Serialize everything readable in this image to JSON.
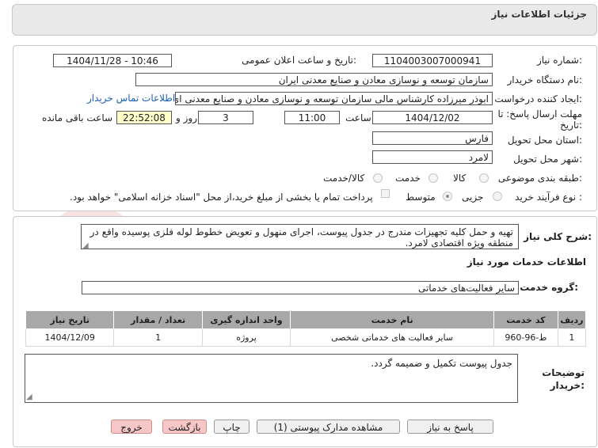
{
  "header": {
    "title": "جزئیات اطلاعات نیاز"
  },
  "form": {
    "need_number_label": "شماره نیاز:",
    "need_number": "1104003007000941",
    "announce_label": "تاریخ و ساعت اعلان عمومی:",
    "announce_value": "1404/11/28 - 10:46",
    "buyer_label": "نام دستگاه خریدار:",
    "buyer_value": "سازمان توسعه و نوسازی معادن و صنایع معدنی ایران",
    "creator_label": "ایجاد کننده درخواست:",
    "creator_value": "ابوذر میرزاده  کارشناس مالی  سازمان توسعه و نوسازی معادن و صنایع معدنی ای",
    "contact_link": "اطلاعات تماس خریدار",
    "deadline_label_1": "مهلت ارسال پاسخ: تا",
    "deadline_label_2": "تاریخ:",
    "deadline_date": "1404/12/02",
    "time_label": "ساعت",
    "deadline_time": "11:00",
    "days_value": "3",
    "days_label": "روز و",
    "remaining_time": "22:52:08",
    "remaining_label": "ساعت باقی مانده",
    "province_label": "استان محل تحویل:",
    "province_value": "فارس",
    "city_label": "شهر محل تحویل:",
    "city_value": "لامرد",
    "category_label": "طبقه بندی موضوعی:",
    "category_options": [
      "کالا",
      "خدمت",
      "کالا/خدمت"
    ],
    "process_label": "نوع فرآیند خرید :",
    "process_options": [
      "جزیی",
      "متوسط"
    ],
    "payment_note": "پرداخت تمام یا بخشی از مبلغ خرید،از محل \"اسناد خزانه اسلامی\" خواهد بود."
  },
  "details": {
    "general_desc_label": "شرح کلی نیاز:",
    "general_desc": "تهیه و حمل کلیه تجهیزات مندرج در جدول پیوست، اجرای منهول و تعویض خطوط لوله فلزی پوسیده واقع در منطقه ویژه اقتصادی لامرد.",
    "services_title": "اطلاعات خدمات مورد نیاز",
    "service_group_label": "گروه خدمت:",
    "service_group_value": "سایر فعالیت‌های خدماتی",
    "table": {
      "headers": [
        "ردیف",
        "کد خدمت",
        "نام خدمت",
        "واحد اندازه گیری",
        "تعداد / مقدار",
        "تاریخ نیاز"
      ],
      "rows": [
        [
          "1",
          "ط-96-960",
          "سایر فعالیت های خدماتی شخصی",
          "پروژه",
          "1",
          "1404/12/09"
        ]
      ]
    },
    "buyer_notes_label_1": "توضیحات",
    "buyer_notes_label_2": "خریدار:",
    "buyer_notes": "جدول پیوست تکمیل و ضمیمه گردد."
  },
  "buttons": {
    "reply": "پاسخ به نیاز",
    "view_docs": "مشاهده مدارک پیوستی (1)",
    "print": "چاپ",
    "back": "بازگشت",
    "exit": "خروج"
  },
  "watermark": {
    "text": "AriaTender.net"
  },
  "colors": {
    "watermark": "#f2caca",
    "table_header": "#a8a8a8",
    "link": "#1a5fb4",
    "time_highlight": "#ffffcc"
  }
}
